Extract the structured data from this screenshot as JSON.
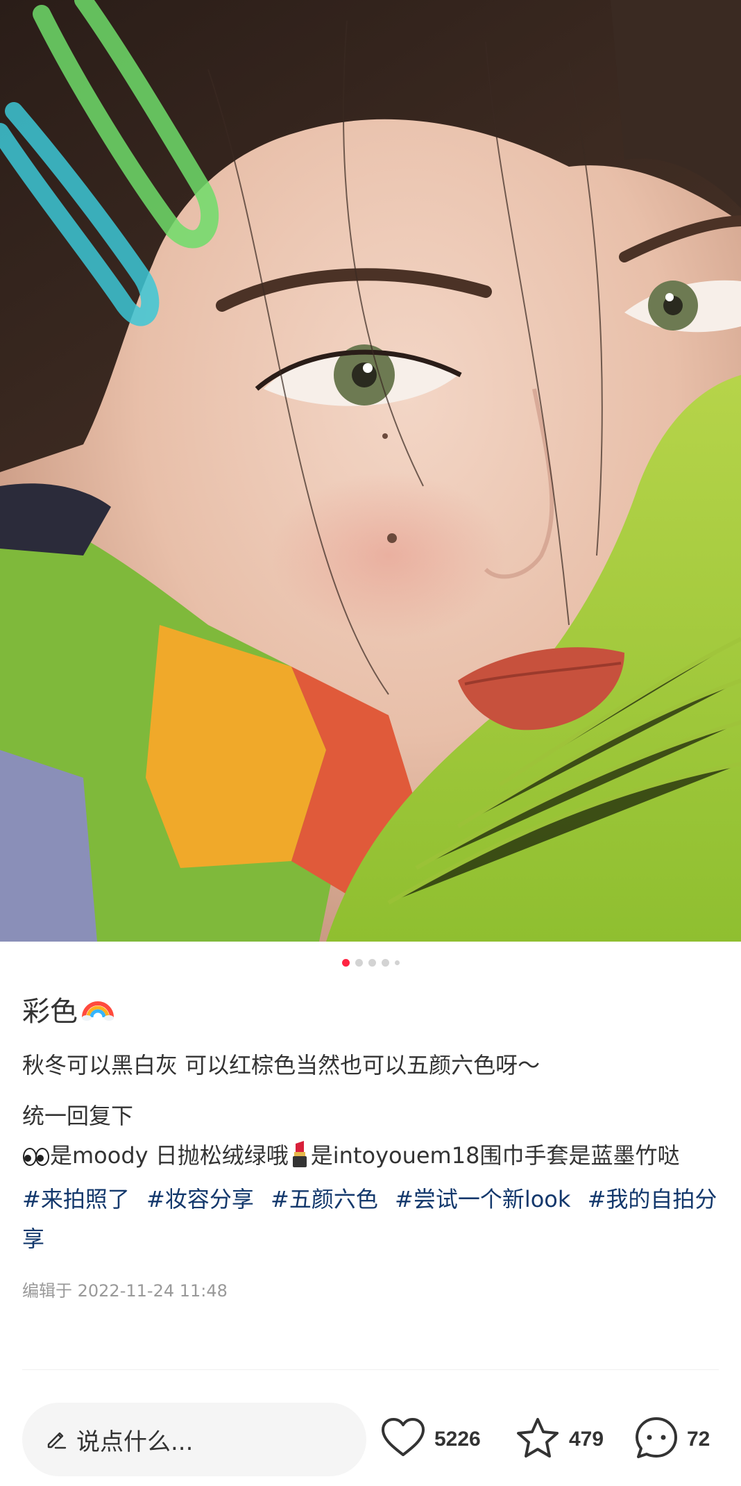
{
  "photo": {
    "description_icon": "portrait-photo",
    "carousel": {
      "count": 5,
      "active_index": 0
    }
  },
  "post": {
    "title": "彩色",
    "title_emoji_icon": "rainbow-icon",
    "body_line1": "秋冬可以黑白灰 可以红棕色当然也可以五颜六色呀～",
    "body_line2": "统一回复下",
    "body_line3_part1": "是moody 日抛松绒绿哦",
    "body_line3_part2": "是intoyouem18围巾手套是蓝墨竹哒",
    "tags": [
      "#来拍照了",
      "#妆容分享",
      "#五颜六色",
      "#尝试一个新look",
      "#我的自拍分享"
    ],
    "edited": "编辑于 2022-11-24 11:48"
  },
  "bottom_bar": {
    "comment_placeholder": "说点什么...",
    "likes": "5226",
    "stars": "479",
    "comments": "72"
  },
  "colors": {
    "accent": "#ff2442",
    "tag": "#13386c",
    "muted": "#999999",
    "input_bg": "#f5f5f5"
  }
}
